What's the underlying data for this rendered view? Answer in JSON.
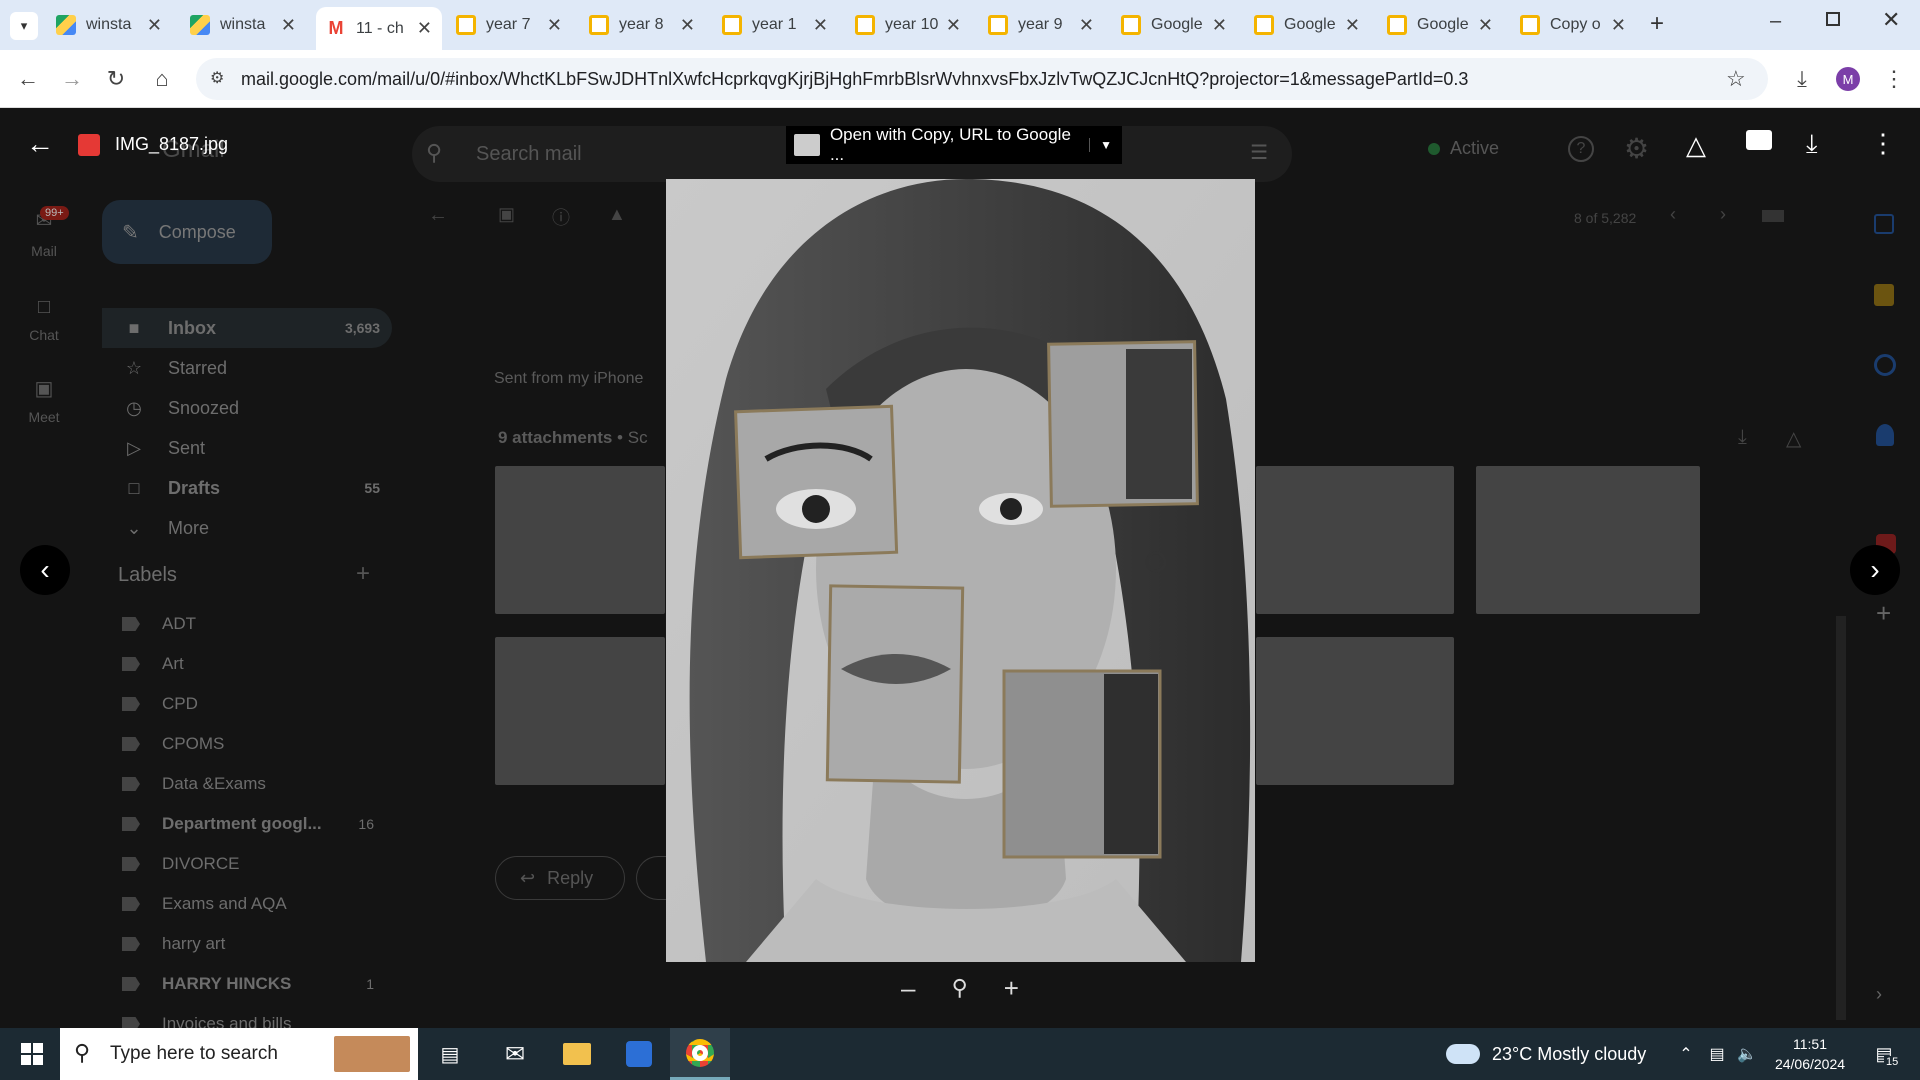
{
  "tabs": [
    {
      "title": "winsta",
      "icon": "drive-icon"
    },
    {
      "title": "winsta",
      "icon": "drive-icon"
    },
    {
      "title": "11 - ch",
      "icon": "gmail-icon",
      "active": true
    },
    {
      "title": "year 7",
      "icon": "slides-icon"
    },
    {
      "title": "year 8",
      "icon": "slides-icon"
    },
    {
      "title": "year 1",
      "icon": "slides-icon"
    },
    {
      "title": "year 10",
      "icon": "slides-icon"
    },
    {
      "title": "year 9",
      "icon": "slides-icon"
    },
    {
      "title": "Google",
      "icon": "slides-icon"
    },
    {
      "title": "Google",
      "icon": "slides-icon"
    },
    {
      "title": "Google",
      "icon": "slides-icon"
    },
    {
      "title": "Copy o",
      "icon": "slides-icon"
    }
  ],
  "browser": {
    "url": "mail.google.com/mail/u/0/#inbox/WhctKLbFSwJDHTnlXwfcHcprkqvgKjrjBjHghFmrbBlsrWvhnxvsFbxJzlvTwQZJCJcnHtQ?projector=1&messagePartId=0.3",
    "profile_initial": "M"
  },
  "gmail": {
    "logo": "Gmail",
    "search_placeholder": "Search mail",
    "status": "Active",
    "compose": "Compose",
    "mail_badge": "99+",
    "rail": [
      "Mail",
      "Chat",
      "Meet"
    ],
    "nav": [
      {
        "label": "Inbox",
        "count": "3,693",
        "bold": true
      },
      {
        "label": "Starred",
        "count": ""
      },
      {
        "label": "Snoozed",
        "count": ""
      },
      {
        "label": "Sent",
        "count": ""
      },
      {
        "label": "Drafts",
        "count": "55",
        "bold": true
      },
      {
        "label": "More",
        "count": ""
      }
    ],
    "labels_heading": "Labels",
    "labels": [
      {
        "name": "ADT",
        "count": ""
      },
      {
        "name": "Art",
        "count": ""
      },
      {
        "name": "CPD",
        "count": ""
      },
      {
        "name": "CPOMS",
        "count": ""
      },
      {
        "name": "Data &Exams",
        "count": ""
      },
      {
        "name": "Department googl...",
        "count": "16",
        "bold": true
      },
      {
        "name": "DIVORCE",
        "count": ""
      },
      {
        "name": "Exams and AQA",
        "count": ""
      },
      {
        "name": "harry art",
        "count": ""
      },
      {
        "name": "HARRY HINCKS",
        "count": "1",
        "bold": true
      },
      {
        "name": "Invoices and bills",
        "count": ""
      }
    ],
    "pager": "8 of 5,282",
    "sent_from": "Sent from my iPhone",
    "attachments": "9 attachments",
    "attachments_suffix": " • Sc",
    "reply": "Reply"
  },
  "viewer": {
    "filename": "IMG_8187.jpg",
    "open_with": "Open with Copy, URL to Google ..."
  },
  "taskbar": {
    "search_placeholder": "Type here to search",
    "weather": "23°C  Mostly cloudy",
    "time": "11:51",
    "date": "24/06/2024",
    "notifications": "15"
  }
}
